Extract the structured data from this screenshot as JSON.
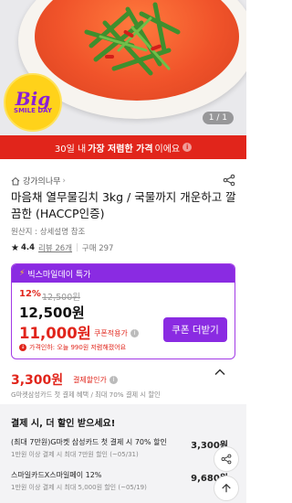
{
  "hero": {
    "badge_big": "Big",
    "badge_sub": "SMILE DAY",
    "pager": "1 / 1"
  },
  "notice": {
    "prefix": "30일 내",
    "bold": "가장 저렴한 가격",
    "suffix": "이에요"
  },
  "seller": {
    "name": "강가의나무"
  },
  "product": {
    "title": "마음채 열무물김치 3kg / 국물까지 개운하고 깔끔한 (HACCP인증)",
    "origin": "원산지 : 상세설명 참조",
    "rating": "4.4",
    "reviews": "리뷰 26개",
    "purchases": "구매 297"
  },
  "promo": {
    "header": "빅스마일데이 특가",
    "discount_pct": "12%",
    "original_price": "12,500원",
    "sale_price": "12,500원",
    "coupon_price": "11,000원",
    "coupon_label": "쿠폰적용가",
    "alert": "가격인하: 오늘 990원 저렴해졌어요",
    "coupon_button": "쿠폰 더받기"
  },
  "card_discount": {
    "price": "3,300원",
    "label": "결제할인가",
    "sub": "G마켓삼성카드 첫 결제 혜택 / 최대 70% 결제 시 할인"
  },
  "benefit": {
    "title": "결제 시, 더 할인 받으세요!",
    "rows": [
      {
        "title": "(최대 7만원)G마켓 삼성카드 첫 결제 시 70% 할인",
        "sub": "1만원 이상 결제 시 최대 7만원 할인 (~05/31)",
        "value": "3,300원"
      },
      {
        "title": "스마일카드X스마일페이 12%",
        "sub": "1만원 이상 결제 시 최대 5,000원 할인 (~05/19)",
        "value": "9,680원"
      }
    ]
  },
  "colors": {
    "accent_red": "#e1251b",
    "accent_purple": "#8a2be2"
  }
}
